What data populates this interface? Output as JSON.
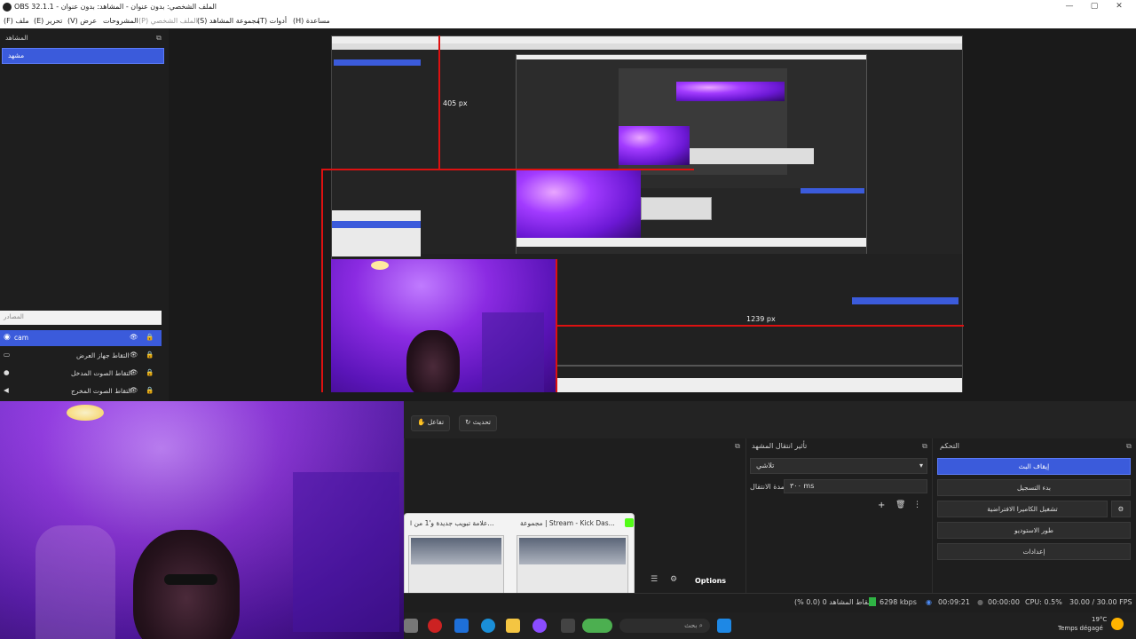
{
  "window": {
    "title": "OBS 32.1.1 - الملف الشخصي: بدون عنوان - المشاهد: بدون عنوان",
    "controls": [
      "—",
      "▢",
      "✕"
    ]
  },
  "menu": [
    "(F) ملف",
    "(E) تحرير",
    "(V) عرض",
    "المشروحات",
    "(P) الملف الشخصي",
    "(S) مجموعة المشاهد",
    "(T) أدوات",
    "(H) مساعدة"
  ],
  "scenes": {
    "title": "المشاهد",
    "items": [
      "مشهد"
    ]
  },
  "preview": {
    "measure_label_1": "405 px",
    "measure_label_2": "1239 px"
  },
  "sources": {
    "title": "المصادر",
    "items": [
      {
        "label": "cam",
        "selected": true,
        "icon": "camera-icon"
      },
      {
        "label": "التقاط جهاز العرض",
        "selected": false,
        "icon": "monitor-icon"
      },
      {
        "label": "التقاط الصوت المدخل",
        "selected": false,
        "icon": "mic-icon"
      },
      {
        "label": "التقاط الصوت المخرج",
        "selected": false,
        "icon": "speaker-icon"
      }
    ]
  },
  "toolbar": {
    "interact": "تفاعل",
    "refresh": "تحديث"
  },
  "transitions": {
    "title": "تأثير انتقال المشهد",
    "type_value": "تلاشي",
    "duration_label": "مدة الانتقال",
    "duration_value": "٣٠٠ ms"
  },
  "controls": {
    "title": "التحكم",
    "buttons": [
      {
        "label": "إيقاف البث",
        "active": true
      },
      {
        "label": "بدء التسجيل",
        "active": false
      },
      {
        "label": "تشغيل الكاميرا الافتراضية",
        "active": false
      },
      {
        "label": "طور الاستوديو",
        "active": false
      },
      {
        "label": "إعدادات",
        "active": false
      }
    ]
  },
  "mixer": {
    "options_label": "Options"
  },
  "popup": {
    "tab1": "مجموعة | Stream - Kick Das...",
    "tab2": "علامة تبويب جديدة و'1 من ا..."
  },
  "status": {
    "dropped": "إسقاط المشاهد 0 (0.0 %)",
    "bitrate": "6298 kbps",
    "stream_time": "00:09:21",
    "rec_time": "00:00:00",
    "cpu": "CPU: 0.5%",
    "fps": "30.00 / 30.00 FPS"
  },
  "taskbar": {
    "search_placeholder": "بحث",
    "weather_temp": "19°C",
    "weather_text": "Temps dégagé"
  },
  "colors": {
    "accent": "#3b5bdb",
    "guide_red": "#dd1111",
    "live_green": "#2fb344"
  }
}
